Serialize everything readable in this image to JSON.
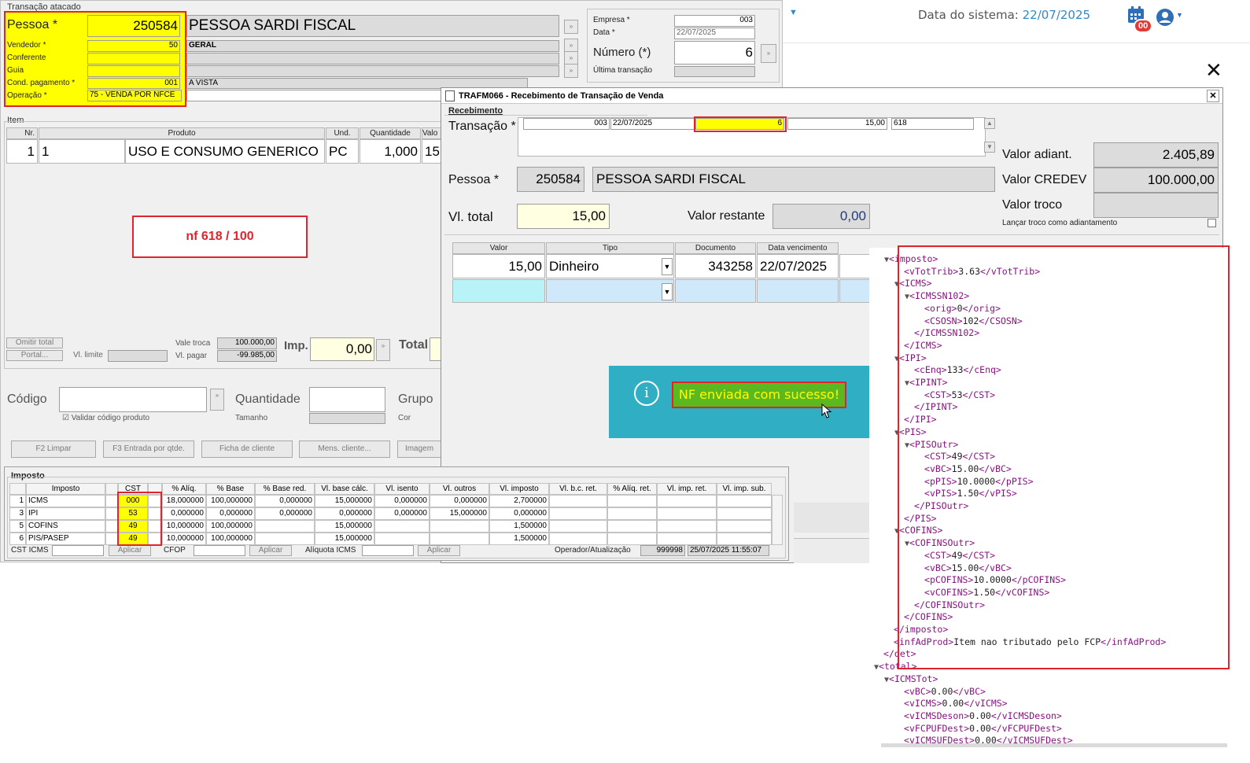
{
  "header": {
    "system_date_label": "Data do sistema:",
    "system_date_value": "22/07/2025",
    "notification_count": "00",
    "close_symbol": "✕"
  },
  "back_window": {
    "title": "Transação atacado",
    "pessoa": {
      "label": "Pessoa *",
      "code": "250584",
      "name": "PESSOA SARDI FISCAL"
    },
    "vendedor": {
      "label": "Vendedor *",
      "value": "50",
      "desc": "GERAL"
    },
    "conferente_label": "Conferente",
    "guia_label": "Guia",
    "cond_pagamento": {
      "label": "Cond. pagamento *",
      "value": "001",
      "desc": "A VISTA"
    },
    "operacao": {
      "label": "Operação *",
      "value": "75 - VENDA POR NFCE"
    },
    "empresa": {
      "label": "Empresa *",
      "value": "003"
    },
    "data": {
      "label": "Data *",
      "value": "22/07/2025"
    },
    "numero": {
      "label": "Número (*)",
      "value": "6"
    },
    "ultima_transacao_label": "Última transação",
    "item_group": "Item",
    "item_headers": [
      "Nr.",
      "Produto",
      "Und.",
      "Quantidade",
      "Valo"
    ],
    "item_row": {
      "nr": "1",
      "cod": "1",
      "produto": "USO E CONSUMO GENERICO",
      "und": "PC",
      "quantidade": "1,000",
      "valor": "15,"
    },
    "annotation": "nf 618 / 100",
    "omitir_total": "Omitir total",
    "portal": "Portal...",
    "vl_limite_label": "Vl. limite",
    "vale_troca": {
      "label": "Vale troca",
      "value": "100.000,00"
    },
    "vl_pagar": {
      "label": "Vl. pagar",
      "value": "-99.985,00"
    },
    "imp": {
      "label": "Imp.",
      "value": "0,00"
    },
    "total_label": "Total",
    "codigo_label": "Código",
    "quantidade_label": "Quantidade",
    "grupo_label": "Grupo",
    "tamanho_label": "Tamanho",
    "cor_label": "Cor",
    "validar_codigo": "Validar código produto",
    "buttons": [
      "F2 Limpar",
      "F3 Entrada por qtde.",
      "Ficha de cliente",
      "Mens. cliente...",
      "Imagem"
    ]
  },
  "imposto": {
    "title": "Imposto",
    "headers": [
      "Imposto",
      "CST",
      "% Alíq.",
      "% Base",
      "% Base red.",
      "Vl. base cálc.",
      "Vl. isento",
      "Vl. outros",
      "Vl. imposto",
      "Vl. b.c. ret.",
      "% Alíq. ret.",
      "Vl. imp. ret.",
      "Vl. imp. sub."
    ],
    "rows": [
      {
        "n": "1",
        "imposto": "ICMS",
        "cst": "000",
        "aliq": "18,000000",
        "base": "100,000000",
        "base_red": "0,000000",
        "base_calc": "15,000000",
        "isento": "0,000000",
        "outros": "0,000000",
        "vl_imposto": "2,700000"
      },
      {
        "n": "3",
        "imposto": "IPI",
        "cst": "53",
        "aliq": "0,000000",
        "base": "0,000000",
        "base_red": "0,000000",
        "base_calc": "0,000000",
        "isento": "0,000000",
        "outros": "15,000000",
        "vl_imposto": "0,000000"
      },
      {
        "n": "5",
        "imposto": "COFINS",
        "cst": "49",
        "aliq": "10,000000",
        "base": "100,000000",
        "base_red": "",
        "base_calc": "15,000000",
        "isento": "",
        "outros": "",
        "vl_imposto": "1,500000"
      },
      {
        "n": "6",
        "imposto": "PIS/PASEP",
        "cst": "49",
        "aliq": "10,000000",
        "base": "100,000000",
        "base_red": "",
        "base_calc": "15,000000",
        "isento": "",
        "outros": "",
        "vl_imposto": "1,500000"
      }
    ],
    "cst_icms_label": "CST ICMS",
    "cfop_label": "CFOP",
    "aliquota_icms_label": "Alíquota ICMS",
    "aplicar": "Aplicar",
    "operador_label": "Operador/Atualização",
    "operador_value": "999998",
    "atualizacao_value": "25/07/2025 11:55:07"
  },
  "dialog": {
    "title": "TRAFM066 - Recebimento de Transação de Venda",
    "recebimento": "Recebimento",
    "transacao": {
      "label": "Transação *",
      "empresa": "003",
      "data": "22/07/2025",
      "numero": "6",
      "valor": "15,00",
      "nf": "618"
    },
    "valor_adiant": {
      "label": "Valor adiant.",
      "value": "2.405,89"
    },
    "valor_credev": {
      "label": "Valor CREDEV",
      "value": "100.000,00"
    },
    "valor_troco_label": "Valor troco",
    "lancar_troco": "Lançar troco como adiantamento",
    "pessoa": {
      "label": "Pessoa *",
      "code": "250584",
      "name": "PESSOA SARDI FISCAL"
    },
    "vl_total": {
      "label": "Vl. total",
      "value": "15,00"
    },
    "valor_restante": {
      "label": "Valor restante",
      "value": "0,00"
    },
    "pay_headers": [
      "Valor",
      "Tipo",
      "Documento",
      "Data vencimento"
    ],
    "pay_row": {
      "valor": "15,00",
      "tipo": "Dinheiro",
      "documento": "343258",
      "vencimento": "22/07/2025"
    },
    "toast": "NF enviada com sucesso!"
  },
  "xml": [
    {
      "d": 1,
      "t": "▼",
      "open": "imposto"
    },
    {
      "d": 2,
      "leaf": "vTotTrib",
      "v": "3.63"
    },
    {
      "d": 2,
      "t": "▼",
      "open": "ICMS"
    },
    {
      "d": 3,
      "t": "▼",
      "open": "ICMSSN102"
    },
    {
      "d": 4,
      "leaf": "orig",
      "v": "0"
    },
    {
      "d": 4,
      "leaf": "CSOSN",
      "v": "102"
    },
    {
      "d": 3,
      "close": "ICMSSN102"
    },
    {
      "d": 2,
      "close": "ICMS"
    },
    {
      "d": 2,
      "t": "▼",
      "open": "IPI"
    },
    {
      "d": 3,
      "leaf": "cEnq",
      "v": "133"
    },
    {
      "d": 3,
      "t": "▼",
      "open": "IPINT"
    },
    {
      "d": 4,
      "leaf": "CST",
      "v": "53"
    },
    {
      "d": 3,
      "close": "IPINT"
    },
    {
      "d": 2,
      "close": "IPI"
    },
    {
      "d": 2,
      "t": "▼",
      "open": "PIS"
    },
    {
      "d": 3,
      "t": "▼",
      "open": "PISOutr"
    },
    {
      "d": 4,
      "leaf": "CST",
      "v": "49"
    },
    {
      "d": 4,
      "leaf": "vBC",
      "v": "15.00"
    },
    {
      "d": 4,
      "leaf": "pPIS",
      "v": "10.0000"
    },
    {
      "d": 4,
      "leaf": "vPIS",
      "v": "1.50"
    },
    {
      "d": 3,
      "close": "PISOutr"
    },
    {
      "d": 2,
      "close": "PIS"
    },
    {
      "d": 2,
      "t": "▼",
      "open": "COFINS"
    },
    {
      "d": 3,
      "t": "▼",
      "open": "COFINSOutr"
    },
    {
      "d": 4,
      "leaf": "CST",
      "v": "49"
    },
    {
      "d": 4,
      "leaf": "vBC",
      "v": "15.00"
    },
    {
      "d": 4,
      "leaf": "pCOFINS",
      "v": "10.0000"
    },
    {
      "d": 4,
      "leaf": "vCOFINS",
      "v": "1.50"
    },
    {
      "d": 3,
      "close": "COFINSOutr"
    },
    {
      "d": 2,
      "close": "COFINS"
    },
    {
      "d": 1,
      "close": "imposto"
    },
    {
      "d": 1,
      "leaf": "infAdProd",
      "v": "Item nao tributado pelo FCP"
    },
    {
      "d": 0,
      "close": "det"
    },
    {
      "d": 0,
      "t": "▼",
      "open": "total"
    },
    {
      "d": 1,
      "t": "▼",
      "open": "ICMSTot"
    },
    {
      "d": 2,
      "leaf": "vBC",
      "v": "0.00"
    },
    {
      "d": 2,
      "leaf": "vICMS",
      "v": "0.00"
    },
    {
      "d": 2,
      "leaf": "vICMSDeson",
      "v": "0.00"
    },
    {
      "d": 2,
      "leaf": "vFCPUFDest",
      "v": "0.00"
    },
    {
      "d": 2,
      "leaf": "vICMSUFDest",
      "v": "0.00"
    }
  ]
}
